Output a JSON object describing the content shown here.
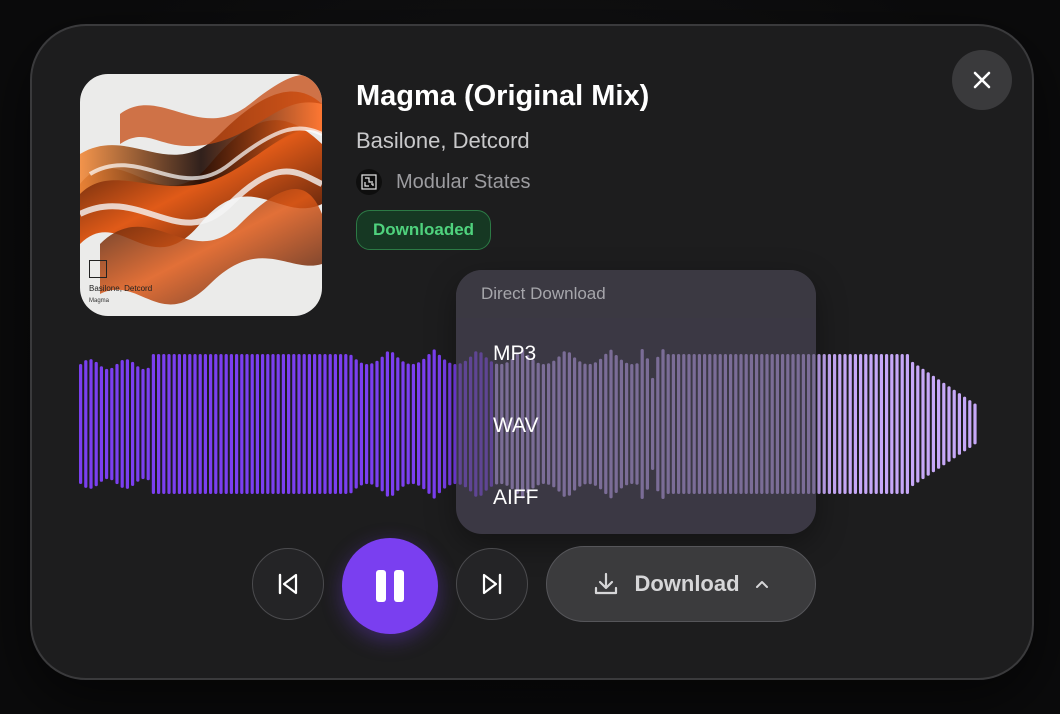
{
  "track": {
    "title": "Magma (Original Mix)",
    "artists": "Basilone, Detcord",
    "label": "Modular States",
    "status": "Downloaded"
  },
  "artwork": {
    "credit": "Basilone, Detcord",
    "title": "Magma"
  },
  "dropdown": {
    "header": "Direct Download",
    "options": [
      "MP3",
      "WAV",
      "AIFF"
    ]
  },
  "controls": {
    "download_label": "Download"
  },
  "icons": {
    "close": "close-icon",
    "previous": "skip-previous-icon",
    "pause": "pause-icon",
    "next": "skip-next-icon",
    "download": "download-icon",
    "chevron": "chevron-up-icon"
  },
  "colors": {
    "accent": "#7a3ff0",
    "played": "#7b3ff0",
    "unplayed": "#c6a8f7",
    "badge_text": "#4fd27d"
  },
  "playback": {
    "progress": 0.46
  }
}
